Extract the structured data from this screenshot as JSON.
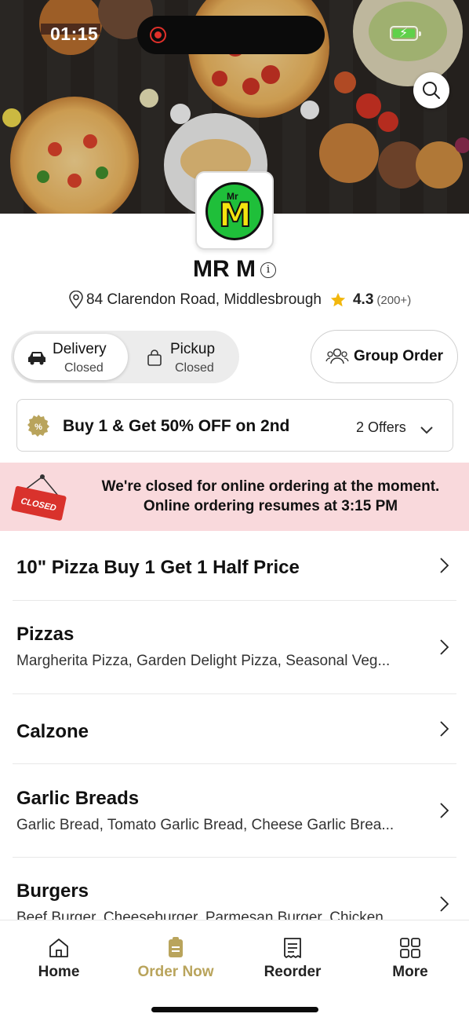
{
  "status_bar": {
    "time": "01:15"
  },
  "restaurant": {
    "logo_text": "Mr",
    "logo_letter": "M",
    "name": "MR M",
    "address": "84 Clarendon Road, Middlesbrough",
    "rating": "4.3",
    "rating_count": "(200+)"
  },
  "mode": {
    "delivery": {
      "label": "Delivery",
      "status": "Closed"
    },
    "pickup": {
      "label": "Pickup",
      "status": "Closed"
    }
  },
  "group_order_label": "Group Order",
  "offer": {
    "text": "Buy 1 & Get 50% OFF on 2nd",
    "count": "2 Offers"
  },
  "closed_banner": {
    "stamp": "CLOSED",
    "line1": "We're closed for online ordering at the moment.",
    "line2": "Online ordering resumes at 3:15 PM"
  },
  "categories": [
    {
      "name": "10\" Pizza Buy 1 Get 1 Half Price",
      "desc": ""
    },
    {
      "name": "Pizzas",
      "desc": "Margherita Pizza, Garden Delight Pizza, Seasonal Veg..."
    },
    {
      "name": "Calzone",
      "desc": ""
    },
    {
      "name": "Garlic Breads",
      "desc": "Garlic Bread, Tomato Garlic Bread, Cheese Garlic Brea..."
    },
    {
      "name": "Burgers",
      "desc": "Beef Burger, Cheeseburger, Parmesan Burger, Chicken..."
    }
  ],
  "nav": {
    "home": "Home",
    "order_now": "Order Now",
    "reorder": "Reorder",
    "more": "More"
  },
  "colors": {
    "accent": "#b9a45c",
    "closed_banner": "#f9d9dc",
    "logo_green": "#1fbf3a"
  }
}
